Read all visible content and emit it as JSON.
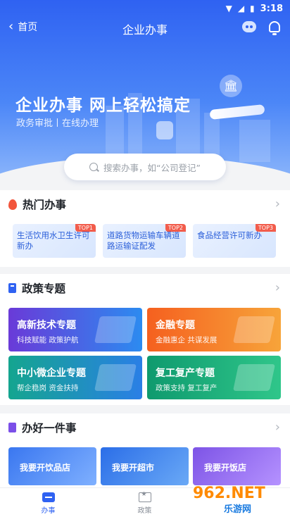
{
  "status_bar": {
    "time": "3:18"
  },
  "nav": {
    "back_label": "首页",
    "title": "企业办事"
  },
  "hero": {
    "title": "企业办事 网上轻松搞定",
    "subtitle": "政务审批丨在线办理"
  },
  "search": {
    "placeholder": "搜索办事，如“公司登记”"
  },
  "hot": {
    "title": "热门办事",
    "items": [
      {
        "label": "生活饮用水卫生许可新办",
        "badge": "TOP1"
      },
      {
        "label": "道路货物运输车辆道路运输证配发",
        "badge": "TOP2"
      },
      {
        "label": "食品经营许可新办",
        "badge": "TOP3"
      }
    ]
  },
  "policy": {
    "title": "政策专题",
    "items": [
      {
        "title": "高新技术专题",
        "subtitle": "科技赋能 政策护航"
      },
      {
        "title": "金融专题",
        "subtitle": "金融惠企 共谋发展"
      },
      {
        "title": "中小微企业专题",
        "subtitle": "帮企稳岗 资金扶持"
      },
      {
        "title": "复工复产专题",
        "subtitle": "政策支持 复工复产"
      }
    ]
  },
  "one_thing": {
    "title": "办好一件事",
    "items": [
      {
        "label": "我要开饮品店"
      },
      {
        "label": "我要开超市"
      },
      {
        "label": "我要开饭店"
      }
    ]
  },
  "tabbar": {
    "tabs": [
      {
        "label": "办事"
      },
      {
        "label": "政策"
      }
    ]
  },
  "watermark": {
    "main": "962.NET",
    "sub": "乐游网"
  },
  "colors": {
    "primary": "#2f62f2",
    "hot_badge": "#f25c4b"
  }
}
